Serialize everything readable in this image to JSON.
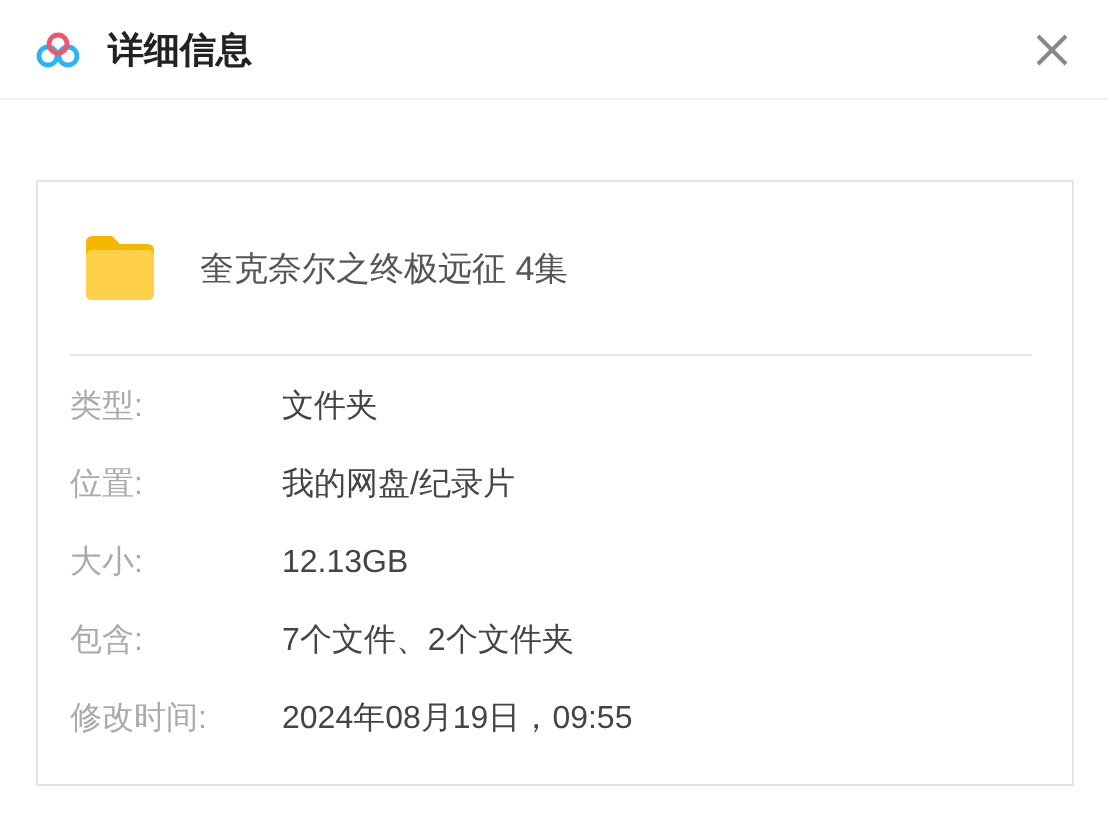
{
  "window": {
    "title": "详细信息"
  },
  "item": {
    "name": "奎克奈尔之终极远征 4集"
  },
  "details": [
    {
      "label": "类型:",
      "value": "文件夹"
    },
    {
      "label": "位置:",
      "value": "我的网盘/纪录片"
    },
    {
      "label": "大小:",
      "value": "12.13GB"
    },
    {
      "label": "包含:",
      "value": "7个文件、2个文件夹"
    },
    {
      "label": "修改时间:",
      "value": "2024年08月19日，09:55"
    }
  ]
}
